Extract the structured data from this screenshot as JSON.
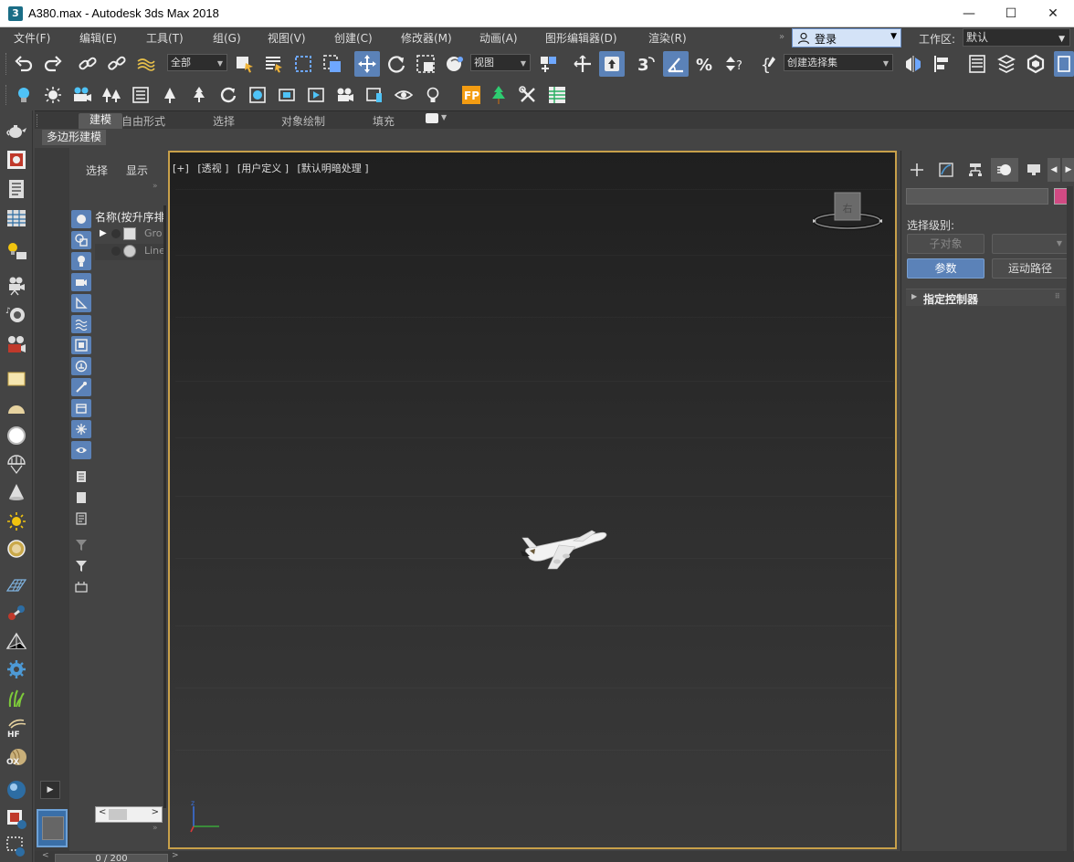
{
  "window": {
    "title": "A380.max - Autodesk 3ds Max 2018",
    "app_icon_text": "3",
    "controls": [
      "—",
      "☐",
      "✕"
    ]
  },
  "menubar": {
    "items": [
      "文件(F)",
      "编辑(E)",
      "工具(T)",
      "组(G)",
      "视图(V)",
      "创建(C)",
      "修改器(M)",
      "动画(A)",
      "图形编辑器(D)",
      "渲染(R)"
    ],
    "login_label": "登录",
    "workspace_label": "工作区:",
    "workspace_value": "默认"
  },
  "toolbar": {
    "selection_filter": "全部",
    "coord_system": "视图",
    "named_selection": "创建选择集"
  },
  "ribbon": {
    "tabs": [
      "建模",
      "自由形式",
      "选择",
      "对象绘制",
      "填充"
    ],
    "sub_tab": "多边形建模"
  },
  "scene_explorer": {
    "tabs": [
      "选择",
      "显示"
    ],
    "column_header": "名称(按升序排",
    "rows": [
      "Gro",
      "Line"
    ]
  },
  "viewport": {
    "labels": [
      "[+]",
      "[透视 ]",
      "[用户定义 ]",
      "[默认明暗处理 ]"
    ],
    "viewcube_face": "右"
  },
  "command_panel": {
    "selection_level_label": "选择级别:",
    "sub_object_button": "子对象",
    "parameters_button": "参数",
    "trajectories_button": "运动路径",
    "rollout_title": "指定控制器",
    "object_color": "#d14a83"
  },
  "timeline": {
    "frame_display": "0 / 200"
  }
}
